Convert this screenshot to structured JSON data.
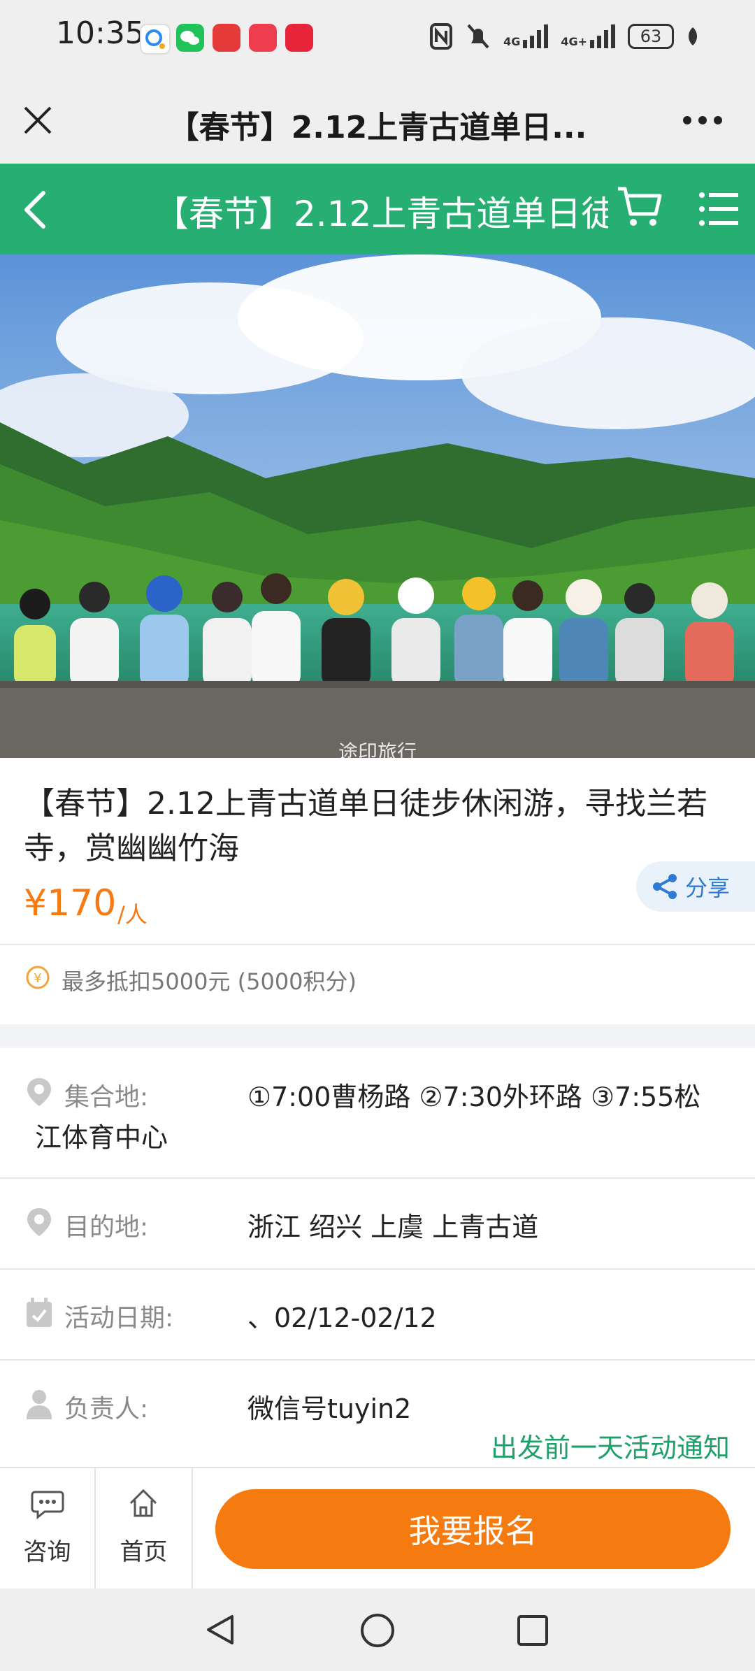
{
  "status_bar": {
    "time": "10:35",
    "battery": "63",
    "network_1": "4G",
    "network_2": "4G+",
    "app_icons": [
      "qq-browser-icon",
      "wechat-icon",
      "app-icon-red-1",
      "huawei-app-icon",
      "app-icon-red-2"
    ]
  },
  "webview": {
    "title": "【春节】2.12上青古道单日..."
  },
  "header": {
    "title": "【春节】2.12上青古道单日徒"
  },
  "hero": {
    "watermark": "途印旅行"
  },
  "product": {
    "title": "【春节】2.12上青古道单日徒步休闲游，寻找兰若寺，赏幽幽竹海",
    "price": "¥170",
    "price_unit": "/人",
    "share_label": "分享",
    "points_text": "最多抵扣5000元 (5000积分)"
  },
  "details": [
    {
      "label": "集合地:",
      "value": "①7:00曹杨路 ②7:30外环路 ③7:55松",
      "value_cont": "江体育中心",
      "icon": "location-pin-icon"
    },
    {
      "label": "目的地:",
      "value": "浙江 绍兴 上虞 上青古道",
      "icon": "location-pin-icon"
    },
    {
      "label": "活动日期:",
      "value": "、02/12-02/12",
      "icon": "calendar-icon"
    },
    {
      "label": "负责人:",
      "value": "微信号tuyin2",
      "icon": "person-icon"
    }
  ],
  "notice": "出发前一天活动通知",
  "bottom_bar": {
    "consult_label": "咨询",
    "home_label": "首页",
    "signup_label": "我要报名"
  },
  "colors": {
    "brand_green": "#27ae73",
    "price_orange": "#f57a14",
    "signup_orange": "#f57b10",
    "notice_green": "#1fa06a",
    "share_blue": "#2f7bd4"
  }
}
